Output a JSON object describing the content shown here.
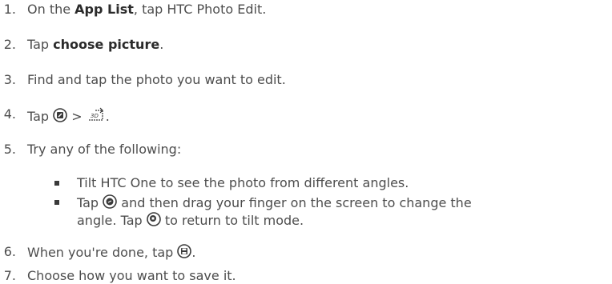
{
  "steps": [
    {
      "num": "1.",
      "pre": "On the ",
      "bold": "App List",
      "post": ", tap HTC Photo Edit."
    },
    {
      "num": "2.",
      "pre": "Tap ",
      "bold": "choose picture",
      "post": "."
    },
    {
      "num": "3.",
      "text": "Find and tap the photo you want to edit."
    },
    {
      "num": "4.",
      "pre": "Tap ",
      "mid": " > ",
      "post": "."
    },
    {
      "num": "5.",
      "text": "Try any of the following:"
    },
    {
      "num": "6.",
      "pre": "When you're done, tap ",
      "post": "."
    },
    {
      "num": "7.",
      "text": "Choose how you want to save it."
    }
  ],
  "bullets": [
    {
      "text": "Tilt HTC One to see the photo from different angles."
    },
    {
      "pre": "Tap ",
      "mid": " and then drag your finger on the screen to change the",
      "line2_pre": "angle. Tap ",
      "line2_post": " to return to tilt mode."
    }
  ],
  "icons": {
    "edit": "edit-icon",
    "threed": "3d-effect-icon",
    "drag": "drag-mode-icon",
    "tilt": "tilt-mode-icon",
    "save": "save-icon"
  }
}
